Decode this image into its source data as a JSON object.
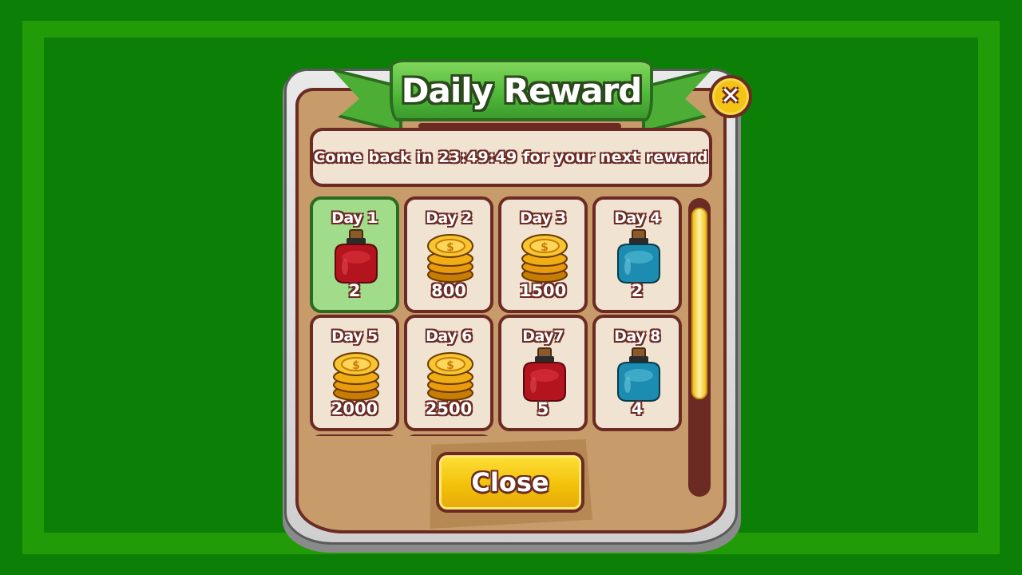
{
  "dialog": {
    "title": "Daily Reward",
    "message": "Come back in 23:49:49 for your next reward",
    "close_button_label": "Close",
    "close_icon": "close-x-icon"
  },
  "rewards": [
    {
      "day": "Day 1",
      "item": "red-potion",
      "amount": "2",
      "claimed": true
    },
    {
      "day": "Day 2",
      "item": "gold-coins",
      "amount": "800",
      "claimed": false
    },
    {
      "day": "Day 3",
      "item": "gold-coins",
      "amount": "1500",
      "claimed": false
    },
    {
      "day": "Day 4",
      "item": "blue-potion",
      "amount": "2",
      "claimed": false
    },
    {
      "day": "Day 5",
      "item": "gold-coins",
      "amount": "2000",
      "claimed": false
    },
    {
      "day": "Day 6",
      "item": "gold-coins",
      "amount": "2500",
      "claimed": false
    },
    {
      "day": "Day7",
      "item": "red-potion",
      "amount": "5",
      "claimed": false
    },
    {
      "day": "Day 8",
      "item": "blue-potion",
      "amount": "4",
      "claimed": false
    }
  ],
  "colors": {
    "background": "#0c7f06",
    "banner_green": "#4fb73a",
    "panel_brown": "#c79c6a",
    "outline": "#6b2b24",
    "gold": "#f2c20a",
    "claimed_cell": "#a1dc8a"
  }
}
